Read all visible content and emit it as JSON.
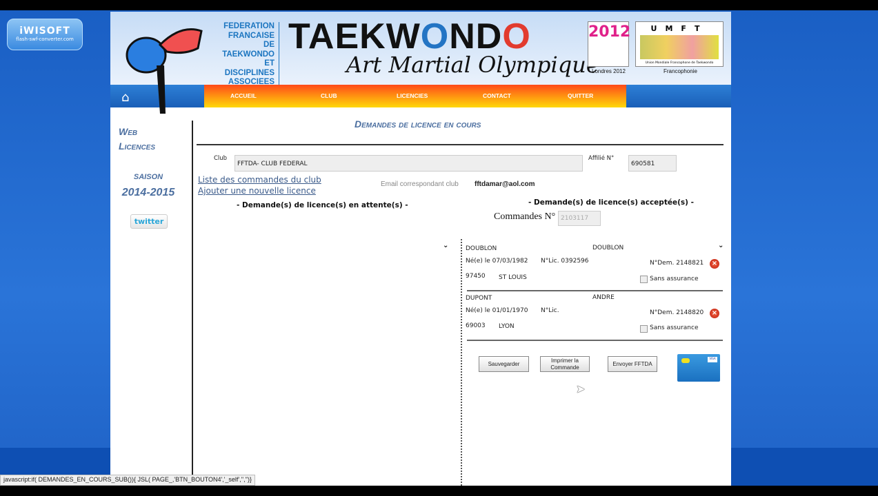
{
  "watermark": {
    "brand": "iWISOFT",
    "url": "flash-swf-converter.com"
  },
  "header": {
    "federation": [
      "FEDERATION",
      "FRANCAISE",
      "DE TAEKWONDO",
      "ET DISCIPLINES",
      "ASSOCIEES"
    ],
    "logo_title_a": "TA",
    "logo_title_b": "EKW",
    "logo_title_o1": "O",
    "logo_title_nd": "ND",
    "logo_title_o2": "O",
    "subtitle": "Art Martial Olympique",
    "london_caption": "Londres 2012",
    "london_logo": "2012",
    "umft_logo": "UMFT",
    "umft_small": "Union Mondiale Francophone de Taekwondo",
    "umft_caption": "Francophonie"
  },
  "nav": {
    "items": [
      "ACCUEIL",
      "CLUB",
      "LICENCIES",
      "CONTACT",
      "QUITTER"
    ]
  },
  "sidebar": {
    "web": "Web",
    "licences": "Licences",
    "saison_label": "SAISON",
    "saison": "2014-2015",
    "twitter": "twitter"
  },
  "main": {
    "title": "Demandes de licence en cours",
    "club_label": "Club",
    "club_value": "FFTDA- CLUB FEDERAL",
    "affilie_label": "Affilié N°",
    "affilie_value": "690581",
    "link_orders": "Liste des commandes du club",
    "link_add": "Ajouter une nouvelle licence",
    "email_label": "Email correspondant club",
    "email_value": "fftdamar@aol.com",
    "pending_title": "- Demande(s) de licence(s) en attente(s) -",
    "accepted_title": "- Demande(s) de licence(s) acceptée(s) -",
    "commandes_label": "Commandes N°",
    "commandes_value": "2103117",
    "licences": [
      {
        "nom": "DOUBLON",
        "prenom": "DOUBLON",
        "naissance": "Né(e) le 07/03/1982",
        "lic": "N°Lic. 0392596",
        "dem": "N°Dem. 2148821",
        "cp": "97450",
        "ville": "ST LOUIS",
        "assurance": "Sans assurance",
        "sans_assurance_checked": false
      },
      {
        "nom": "DUPONT",
        "prenom": "ANDRE",
        "naissance": "Né(e) le 01/01/1970",
        "lic": "N°Lic.",
        "dem": "N°Dem. 2148820",
        "cp": "69003",
        "ville": "LYON",
        "assurance": "Sans assurance",
        "sans_assurance_checked": false
      }
    ],
    "btn_save": "Sauvegarder",
    "btn_print": "Imprimer la Commande",
    "btn_send": "Envoyer FFTDA",
    "card_visa": "VISA"
  },
  "statusbar": "javascript:if( DEMANDES_EN_COURS_SUB()){ JSL( PAGE_,'BTN_BOUTON4','_self','','')}"
}
